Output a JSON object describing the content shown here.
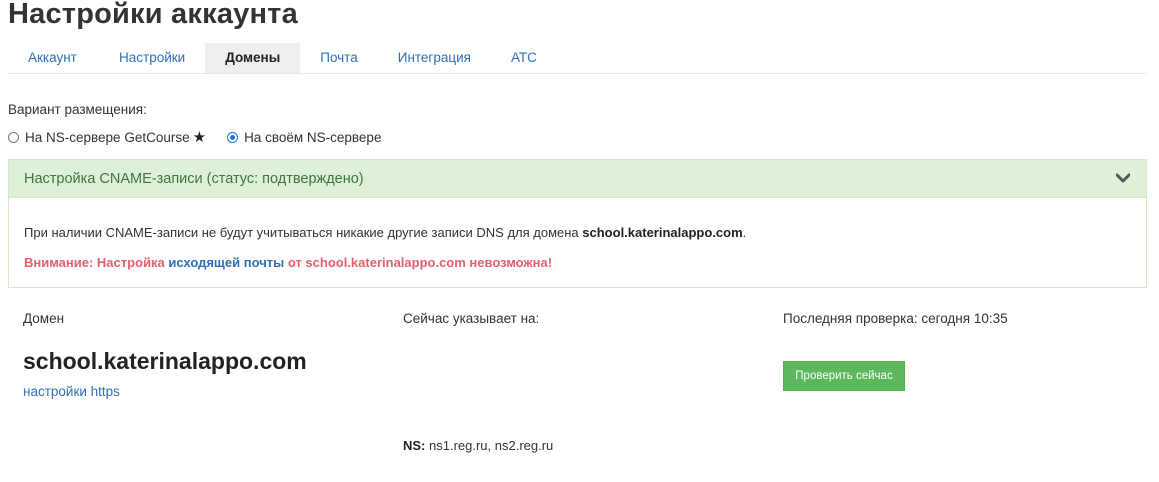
{
  "page": {
    "title": "Настройки аккаунта"
  },
  "tabs": [
    {
      "label": "Аккаунт",
      "active": false
    },
    {
      "label": "Настройки",
      "active": false
    },
    {
      "label": "Домены",
      "active": true
    },
    {
      "label": "Почта",
      "active": false
    },
    {
      "label": "Интеграция",
      "active": false
    },
    {
      "label": "АТС",
      "active": false
    }
  ],
  "placement": {
    "label": "Вариант размещения:",
    "options": [
      {
        "label": "На NS-сервере GetCourse",
        "star": "★",
        "checked": false
      },
      {
        "label": "На своём NS-сервере",
        "checked": true
      }
    ]
  },
  "cname_panel": {
    "title": "Настройка CNAME-записи (статус: подтверждено)",
    "info_prefix": "При наличии CNAME-записи не будут учитываться никакие другие записи DNS для домена ",
    "info_domain": "school.katerinalappo.com",
    "info_suffix": ".",
    "warning_prefix": "Внимание: Настройка ",
    "warning_link": "исходящей почты",
    "warning_suffix": " от school.katerinalappo.com невозможна!"
  },
  "domain_table": {
    "col_domain": "Домен",
    "col_points_to": "Сейчас указывает на:",
    "col_last_check": "Последняя проверка: сегодня 10:35",
    "domain_name": "school.katerinalappo.com",
    "https_link": "настройки https",
    "check_button": "Проверить сейчас",
    "ns_label": "NS:",
    "ns_value": " ns1.reg.ru, ns2.reg.ru"
  },
  "colors": {
    "link": "#2f6fb5",
    "success_bg": "#dff0d8",
    "success_text": "#3c763d",
    "warning_text": "#e4606d",
    "button_green": "#5cb85c"
  }
}
